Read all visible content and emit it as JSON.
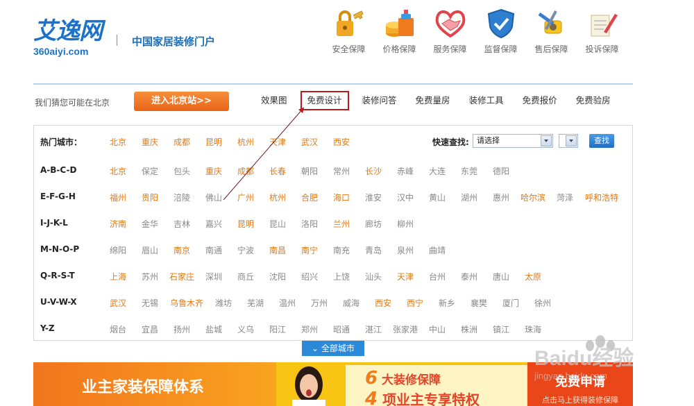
{
  "header": {
    "logo_cn": "艾逸网",
    "logo_en": "360aiyi.com",
    "slogan": "中国家居装修门户",
    "guarantees": [
      {
        "label": "安全保障",
        "icon": "lock-key-icon"
      },
      {
        "label": "价格保障",
        "icon": "price-coins-icon"
      },
      {
        "label": "服务保障",
        "icon": "handshake-heart-icon"
      },
      {
        "label": "监督保障",
        "icon": "shield-check-icon"
      },
      {
        "label": "售后保障",
        "icon": "tools-tape-icon"
      },
      {
        "label": "投诉保障",
        "icon": "complaint-pen-icon"
      }
    ]
  },
  "locbar": {
    "guess_text": "我们猜您可能在北京",
    "enter_button": "进入北京站>>",
    "nav": [
      "效果图",
      "免费设计",
      "装修问答",
      "免费量房",
      "装修工具",
      "免费报价",
      "免费验房"
    ],
    "selected_nav": "免费设计"
  },
  "panel": {
    "hot_label": "热门城市：",
    "hot_cities": [
      "北京",
      "重庆",
      "成都",
      "昆明",
      "杭州",
      "天津",
      "武汉",
      "西安"
    ],
    "quick_find_label": "快速查找:",
    "quick_find_select": "请选择",
    "search_button": "查找",
    "rows": [
      {
        "label": "A-B-C-D",
        "cities": [
          {
            "n": "北京",
            "hot": true
          },
          {
            "n": "保定",
            "hot": false
          },
          {
            "n": "包头",
            "hot": false
          },
          {
            "n": "重庆",
            "hot": true
          },
          {
            "n": "成都",
            "hot": true
          },
          {
            "n": "长春",
            "hot": true
          },
          {
            "n": "朝阳",
            "hot": false
          },
          {
            "n": "常州",
            "hot": false
          },
          {
            "n": "长沙",
            "hot": true
          },
          {
            "n": "赤峰",
            "hot": false
          },
          {
            "n": "大连",
            "hot": false
          },
          {
            "n": "东莞",
            "hot": false
          },
          {
            "n": "德阳",
            "hot": false
          }
        ]
      },
      {
        "label": "E-F-G-H",
        "cities": [
          {
            "n": "福州",
            "hot": true
          },
          {
            "n": "贵阳",
            "hot": true
          },
          {
            "n": "涪陵",
            "hot": false
          },
          {
            "n": "佛山",
            "hot": false
          },
          {
            "n": "广州",
            "hot": true
          },
          {
            "n": "杭州",
            "hot": true
          },
          {
            "n": "合肥",
            "hot": true
          },
          {
            "n": "海口",
            "hot": true
          },
          {
            "n": "淮安",
            "hot": false
          },
          {
            "n": "汉中",
            "hot": false
          },
          {
            "n": "黄山",
            "hot": false
          },
          {
            "n": "湖州",
            "hot": false
          },
          {
            "n": "惠州",
            "hot": false
          },
          {
            "n": "哈尔滨",
            "hot": true
          },
          {
            "n": "菏泽",
            "hot": false
          },
          {
            "n": "呼和浩特",
            "hot": true
          }
        ]
      },
      {
        "label": "I-J-K-L",
        "cities": [
          {
            "n": "济南",
            "hot": true
          },
          {
            "n": "金华",
            "hot": false
          },
          {
            "n": "吉林",
            "hot": false
          },
          {
            "n": "嘉兴",
            "hot": false
          },
          {
            "n": "昆明",
            "hot": true
          },
          {
            "n": "昆山",
            "hot": false
          },
          {
            "n": "洛阳",
            "hot": false
          },
          {
            "n": "兰州",
            "hot": true
          },
          {
            "n": "廊坊",
            "hot": false
          },
          {
            "n": "柳州",
            "hot": false
          }
        ]
      },
      {
        "label": "M-N-O-P",
        "cities": [
          {
            "n": "绵阳",
            "hot": false
          },
          {
            "n": "眉山",
            "hot": false
          },
          {
            "n": "南京",
            "hot": true
          },
          {
            "n": "南通",
            "hot": false
          },
          {
            "n": "宁波",
            "hot": false
          },
          {
            "n": "南昌",
            "hot": true
          },
          {
            "n": "南宁",
            "hot": true
          },
          {
            "n": "南充",
            "hot": false
          },
          {
            "n": "青岛",
            "hot": false
          },
          {
            "n": "泉州",
            "hot": false
          },
          {
            "n": "曲靖",
            "hot": false
          }
        ]
      },
      {
        "label": "Q-R-S-T",
        "cities": [
          {
            "n": "上海",
            "hot": true
          },
          {
            "n": "苏州",
            "hot": false
          },
          {
            "n": "石家庄",
            "hot": true
          },
          {
            "n": "深圳",
            "hot": false
          },
          {
            "n": "商丘",
            "hot": false
          },
          {
            "n": "沈阳",
            "hot": false
          },
          {
            "n": "绍兴",
            "hot": false
          },
          {
            "n": "上饶",
            "hot": false
          },
          {
            "n": "汕头",
            "hot": false
          },
          {
            "n": "天津",
            "hot": true
          },
          {
            "n": "台州",
            "hot": false
          },
          {
            "n": "泰州",
            "hot": false
          },
          {
            "n": "唐山",
            "hot": false
          },
          {
            "n": "太原",
            "hot": true
          }
        ]
      },
      {
        "label": "U-V-W-X",
        "cities": [
          {
            "n": "武汉",
            "hot": true
          },
          {
            "n": "无锡",
            "hot": false
          },
          {
            "n": "乌鲁木齐",
            "hot": true
          },
          {
            "n": "潍坊",
            "hot": false
          },
          {
            "n": "芜湖",
            "hot": false
          },
          {
            "n": "温州",
            "hot": false
          },
          {
            "n": "万州",
            "hot": false
          },
          {
            "n": "威海",
            "hot": false
          },
          {
            "n": "西安",
            "hot": true
          },
          {
            "n": "西宁",
            "hot": true
          },
          {
            "n": "新乡",
            "hot": false
          },
          {
            "n": "襄樊",
            "hot": false
          },
          {
            "n": "厦门",
            "hot": false
          },
          {
            "n": "徐州",
            "hot": false
          }
        ]
      },
      {
        "label": "Y-Z",
        "cities": [
          {
            "n": "烟台",
            "hot": false
          },
          {
            "n": "宜昌",
            "hot": false
          },
          {
            "n": "扬州",
            "hot": false
          },
          {
            "n": "盐城",
            "hot": false
          },
          {
            "n": "义乌",
            "hot": false
          },
          {
            "n": "阳江",
            "hot": false
          },
          {
            "n": "郑州",
            "hot": false
          },
          {
            "n": "昭通",
            "hot": false
          },
          {
            "n": "湛江",
            "hot": false
          },
          {
            "n": "张家港",
            "hot": false
          },
          {
            "n": "中山",
            "hot": false
          },
          {
            "n": "株洲",
            "hot": false
          },
          {
            "n": "镇江",
            "hot": false
          },
          {
            "n": "珠海",
            "hot": false
          }
        ]
      }
    ],
    "all_cities_button": "全部城市"
  },
  "banner": {
    "slogan": "业主家装保障体系",
    "line1_num": "6",
    "line1_text": "大装修保障",
    "line2_num": "4",
    "line2_text": "项业主专享特权",
    "apply": "免费申请",
    "apply_sub": "点击马上获得装修保障"
  },
  "watermark": {
    "brand": "Baidu经验",
    "url": "jingyan.baidu.com"
  },
  "colors": {
    "brand_blue": "#1a73c7",
    "hot_city": "#e07a14",
    "normal_city": "#888888",
    "enter_button": "#f07a2a",
    "highlight_box": "#c0191b",
    "all_cities_button": "#2a8ad9"
  }
}
